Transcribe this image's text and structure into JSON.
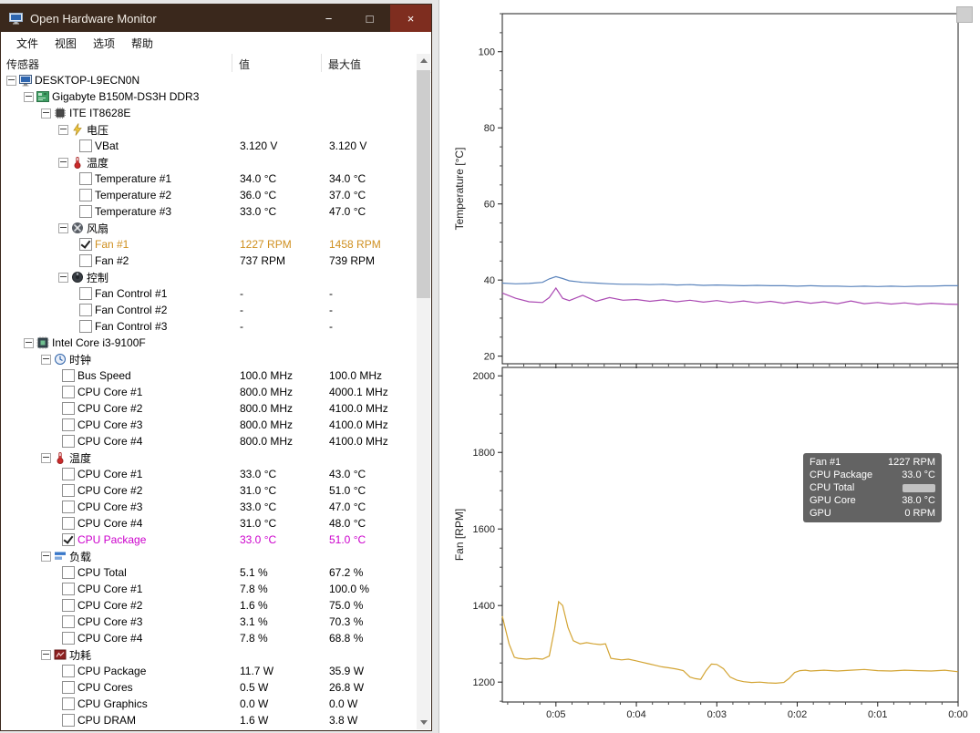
{
  "window": {
    "title": "Open Hardware Monitor",
    "controls": {
      "minimize": "−",
      "maximize": "□",
      "close": "×"
    }
  },
  "menu": {
    "items": [
      "文件",
      "视图",
      "选项",
      "帮助"
    ]
  },
  "colors": {
    "titlebar": "#3a281c",
    "fan_accent": "#cf8f1f",
    "package_accent": "#cc00cc",
    "temp_line_blue": "#5b84bc",
    "temp_line_magenta": "#ab4ab3",
    "fan_line_orange": "#d3a433"
  },
  "tree": {
    "columns": [
      "传感器",
      "值",
      "最大值"
    ],
    "rows": [
      {
        "level": 0,
        "expander": true,
        "icon": "computer",
        "label": "DESKTOP-L9ECN0N"
      },
      {
        "level": 1,
        "expander": true,
        "icon": "mainboard",
        "label": "Gigabyte B150M-DS3H DDR3"
      },
      {
        "level": 2,
        "expander": true,
        "icon": "chip",
        "label": "ITE IT8628E"
      },
      {
        "level": 3,
        "expander": true,
        "icon": "voltage",
        "label": "电压"
      },
      {
        "level": 4,
        "checkbox": "unchecked",
        "label": "VBat",
        "value": "3.120 V",
        "max": "3.120 V"
      },
      {
        "level": 3,
        "expander": true,
        "icon": "temperature",
        "label": "温度"
      },
      {
        "level": 4,
        "checkbox": "unchecked",
        "label": "Temperature #1",
        "value": "34.0 °C",
        "max": "34.0 °C"
      },
      {
        "level": 4,
        "checkbox": "unchecked",
        "label": "Temperature #2",
        "value": "36.0 °C",
        "max": "37.0 °C"
      },
      {
        "level": 4,
        "checkbox": "unchecked",
        "label": "Temperature #3",
        "value": "33.0 °C",
        "max": "47.0 °C"
      },
      {
        "level": 3,
        "expander": true,
        "icon": "fan",
        "label": "风扇"
      },
      {
        "level": 4,
        "checkbox": "checked",
        "label": "Fan #1",
        "value": "1227 RPM",
        "max": "1458 RPM",
        "color": "orange"
      },
      {
        "level": 4,
        "checkbox": "unchecked",
        "label": "Fan #2",
        "value": "737 RPM",
        "max": "739 RPM"
      },
      {
        "level": 3,
        "expander": true,
        "icon": "control",
        "label": "控制"
      },
      {
        "level": 4,
        "checkbox": "unchecked",
        "label": "Fan Control #1",
        "value": "-",
        "max": "-"
      },
      {
        "level": 4,
        "checkbox": "unchecked",
        "label": "Fan Control #2",
        "value": "-",
        "max": "-"
      },
      {
        "level": 4,
        "checkbox": "unchecked",
        "label": "Fan Control #3",
        "value": "-",
        "max": "-"
      },
      {
        "level": 1,
        "expander": true,
        "icon": "cpu",
        "label": "Intel Core i3-9100F"
      },
      {
        "level": 2,
        "expander": true,
        "icon": "clock",
        "label": "时钟"
      },
      {
        "level": 3,
        "checkbox": "unchecked",
        "label": "Bus Speed",
        "value": "100.0 MHz",
        "max": "100.0 MHz"
      },
      {
        "level": 3,
        "checkbox": "unchecked",
        "label": "CPU Core #1",
        "value": "800.0 MHz",
        "max": "4000.1 MHz"
      },
      {
        "level": 3,
        "checkbox": "unchecked",
        "label": "CPU Core #2",
        "value": "800.0 MHz",
        "max": "4100.0 MHz"
      },
      {
        "level": 3,
        "checkbox": "unchecked",
        "label": "CPU Core #3",
        "value": "800.0 MHz",
        "max": "4100.0 MHz"
      },
      {
        "level": 3,
        "checkbox": "unchecked",
        "label": "CPU Core #4",
        "value": "800.0 MHz",
        "max": "4100.0 MHz"
      },
      {
        "level": 2,
        "expander": true,
        "icon": "temperature",
        "label": "温度"
      },
      {
        "level": 3,
        "checkbox": "unchecked",
        "label": "CPU Core #1",
        "value": "33.0 °C",
        "max": "43.0 °C"
      },
      {
        "level": 3,
        "checkbox": "unchecked",
        "label": "CPU Core #2",
        "value": "31.0 °C",
        "max": "51.0 °C"
      },
      {
        "level": 3,
        "checkbox": "unchecked",
        "label": "CPU Core #3",
        "value": "33.0 °C",
        "max": "47.0 °C"
      },
      {
        "level": 3,
        "checkbox": "unchecked",
        "label": "CPU Core #4",
        "value": "31.0 °C",
        "max": "48.0 °C"
      },
      {
        "level": 3,
        "checkbox": "checked",
        "label": "CPU Package",
        "value": "33.0 °C",
        "max": "51.0 °C",
        "color": "magenta"
      },
      {
        "level": 2,
        "expander": true,
        "icon": "load",
        "label": "负载"
      },
      {
        "level": 3,
        "checkbox": "unchecked",
        "label": "CPU Total",
        "value": "5.1 %",
        "max": "67.2 %"
      },
      {
        "level": 3,
        "checkbox": "unchecked",
        "label": "CPU Core #1",
        "value": "7.8 %",
        "max": "100.0 %"
      },
      {
        "level": 3,
        "checkbox": "unchecked",
        "label": "CPU Core #2",
        "value": "1.6 %",
        "max": "75.0 %"
      },
      {
        "level": 3,
        "checkbox": "unchecked",
        "label": "CPU Core #3",
        "value": "3.1 %",
        "max": "70.3 %"
      },
      {
        "level": 3,
        "checkbox": "unchecked",
        "label": "CPU Core #4",
        "value": "7.8 %",
        "max": "68.8 %"
      },
      {
        "level": 2,
        "expander": true,
        "icon": "power",
        "label": "功耗"
      },
      {
        "level": 3,
        "checkbox": "unchecked",
        "label": "CPU Package",
        "value": "11.7 W",
        "max": "35.9 W"
      },
      {
        "level": 3,
        "checkbox": "unchecked",
        "label": "CPU Cores",
        "value": "0.5 W",
        "max": "26.8 W"
      },
      {
        "level": 3,
        "checkbox": "unchecked",
        "label": "CPU Graphics",
        "value": "0.0 W",
        "max": "0.0 W"
      },
      {
        "level": 3,
        "checkbox": "unchecked",
        "label": "CPU DRAM",
        "value": "1.6 W",
        "max": "3.8 W"
      }
    ]
  },
  "tooltip": {
    "rows": [
      {
        "label": "Fan #1",
        "value": "1227 RPM"
      },
      {
        "label": "CPU Package",
        "value": "33.0 °C"
      },
      {
        "label": "CPU Total",
        "value": ""
      },
      {
        "label": "GPU Core",
        "value": "38.0 °C"
      },
      {
        "label": "GPU",
        "value": "0 RPM"
      }
    ]
  },
  "chart_data": [
    {
      "type": "line",
      "title": "",
      "xlabel": "",
      "ylabel": "Temperature [°C]",
      "ylim": [
        18,
        110
      ],
      "yticks": [
        20,
        40,
        60,
        80,
        100
      ],
      "y_minor_step": 5,
      "grid": false,
      "legend_position": "none",
      "x_range_seconds": [
        340,
        0
      ],
      "xticks_seconds": [
        300,
        240,
        180,
        120,
        60,
        0
      ],
      "xtick_labels": [
        "0:05",
        "0:04",
        "0:03",
        "0:02",
        "0:01",
        "0:00"
      ],
      "x_minor_step_seconds": 12,
      "series": [
        {
          "name": "GPU Core",
          "color": "#5b84bc",
          "x_seconds_ago": [
            340,
            330,
            320,
            310,
            305,
            300,
            295,
            290,
            280,
            270,
            260,
            250,
            240,
            230,
            220,
            210,
            200,
            190,
            180,
            170,
            160,
            150,
            140,
            130,
            120,
            110,
            100,
            90,
            80,
            70,
            60,
            50,
            40,
            30,
            20,
            10,
            0
          ],
          "values": [
            39.2,
            39.0,
            39.1,
            39.4,
            40.3,
            40.9,
            40.4,
            39.8,
            39.4,
            39.2,
            39.0,
            38.9,
            38.9,
            38.8,
            38.9,
            38.7,
            38.8,
            38.6,
            38.7,
            38.6,
            38.5,
            38.6,
            38.5,
            38.5,
            38.4,
            38.5,
            38.4,
            38.4,
            38.3,
            38.4,
            38.3,
            38.4,
            38.3,
            38.4,
            38.4,
            38.5,
            38.5
          ]
        },
        {
          "name": "CPU Package",
          "color": "#ab4ab3",
          "x_seconds_ago": [
            340,
            330,
            320,
            310,
            305,
            300,
            295,
            290,
            280,
            270,
            260,
            250,
            240,
            230,
            220,
            210,
            200,
            190,
            180,
            170,
            160,
            150,
            140,
            130,
            120,
            110,
            100,
            90,
            80,
            70,
            60,
            50,
            40,
            30,
            20,
            10,
            0
          ],
          "values": [
            36.6,
            35.2,
            34.3,
            34.1,
            35.4,
            37.9,
            35.2,
            34.6,
            36.0,
            34.4,
            35.4,
            34.7,
            34.9,
            34.4,
            34.8,
            34.3,
            34.7,
            34.2,
            34.6,
            34.1,
            34.5,
            34.0,
            34.4,
            33.9,
            34.4,
            33.9,
            34.3,
            33.8,
            34.5,
            33.8,
            34.1,
            33.7,
            34.0,
            33.6,
            33.9,
            33.7,
            33.6
          ]
        }
      ]
    },
    {
      "type": "line",
      "title": "",
      "xlabel": "",
      "ylabel": "Fan [RPM]",
      "ylim": [
        1148,
        2022
      ],
      "yticks": [
        1200,
        1400,
        1600,
        1800,
        2000
      ],
      "y_minor_step": 50,
      "grid": false,
      "legend_position": "none",
      "x_range_seconds": [
        340,
        0
      ],
      "xticks_seconds": [
        300,
        240,
        180,
        120,
        60,
        0
      ],
      "xtick_labels": [
        "0:05",
        "0:04",
        "0:03",
        "0:02",
        "0:01",
        "0:00"
      ],
      "x_minor_step_seconds": 12,
      "show_x_labels": true,
      "series": [
        {
          "name": "Fan #1",
          "color": "#d3a433",
          "x_seconds_ago": [
            340,
            335,
            331,
            328,
            322,
            316,
            310,
            305,
            301,
            298,
            295,
            291,
            287,
            282,
            277,
            272,
            267,
            263,
            259,
            255,
            251,
            246,
            241,
            236,
            231,
            226,
            221,
            215,
            210,
            205,
            200,
            196,
            192,
            188,
            184,
            180,
            175,
            170,
            165,
            160,
            154,
            148,
            142,
            136,
            130,
            126,
            122,
            118,
            114,
            110,
            100,
            90,
            80,
            70,
            60,
            50,
            40,
            30,
            20,
            10,
            0
          ],
          "values": [
            1372,
            1300,
            1265,
            1262,
            1260,
            1262,
            1260,
            1268,
            1340,
            1410,
            1400,
            1342,
            1308,
            1300,
            1303,
            1300,
            1298,
            1300,
            1262,
            1260,
            1258,
            1260,
            1256,
            1252,
            1248,
            1244,
            1240,
            1237,
            1234,
            1230,
            1213,
            1209,
            1207,
            1230,
            1247,
            1246,
            1235,
            1213,
            1205,
            1201,
            1199,
            1200,
            1198,
            1197,
            1199,
            1210,
            1225,
            1230,
            1231,
            1229,
            1231,
            1229,
            1231,
            1233,
            1230,
            1229,
            1231,
            1230,
            1229,
            1231,
            1227
          ]
        }
      ]
    }
  ]
}
